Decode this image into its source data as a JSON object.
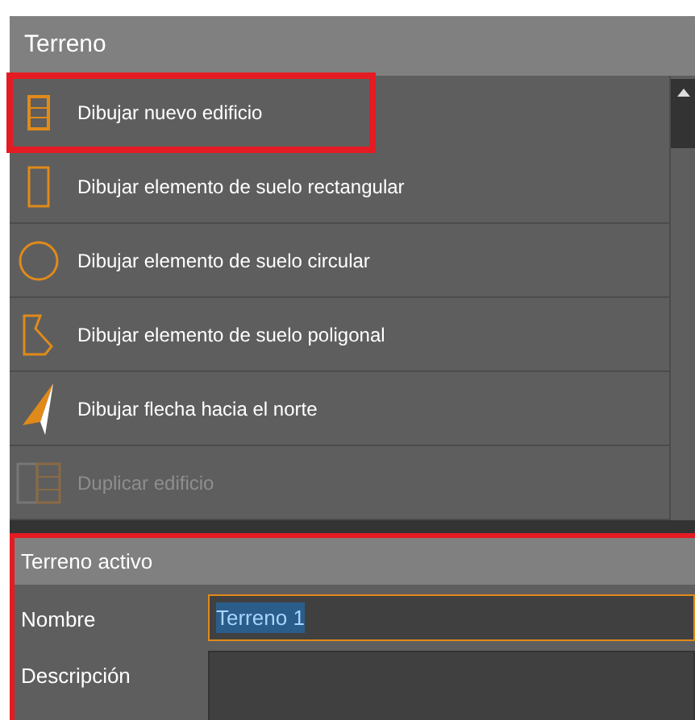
{
  "panel": {
    "title": "Terreno"
  },
  "commands": [
    {
      "kind": "building",
      "label": "Dibujar nuevo edificio",
      "disabled": false,
      "highlighted": true
    },
    {
      "kind": "rectangle",
      "label": "Dibujar elemento de suelo rectangular",
      "disabled": false,
      "highlighted": false
    },
    {
      "kind": "circle",
      "label": "Dibujar elemento de suelo circular",
      "disabled": false,
      "highlighted": false
    },
    {
      "kind": "polygon",
      "label": "Dibujar elemento de suelo poligonal",
      "disabled": false,
      "highlighted": false
    },
    {
      "kind": "arrow",
      "label": "Dibujar flecha hacia el norte",
      "disabled": false,
      "highlighted": false
    },
    {
      "kind": "duplicate",
      "label": "Duplicar edificio",
      "disabled": true,
      "highlighted": false
    }
  ],
  "active_terrain": {
    "title": "Terreno activo",
    "highlighted": true,
    "fields": [
      {
        "label": "Nombre",
        "value": "Terreno 1"
      },
      {
        "label": "Descripción"
      }
    ]
  }
}
